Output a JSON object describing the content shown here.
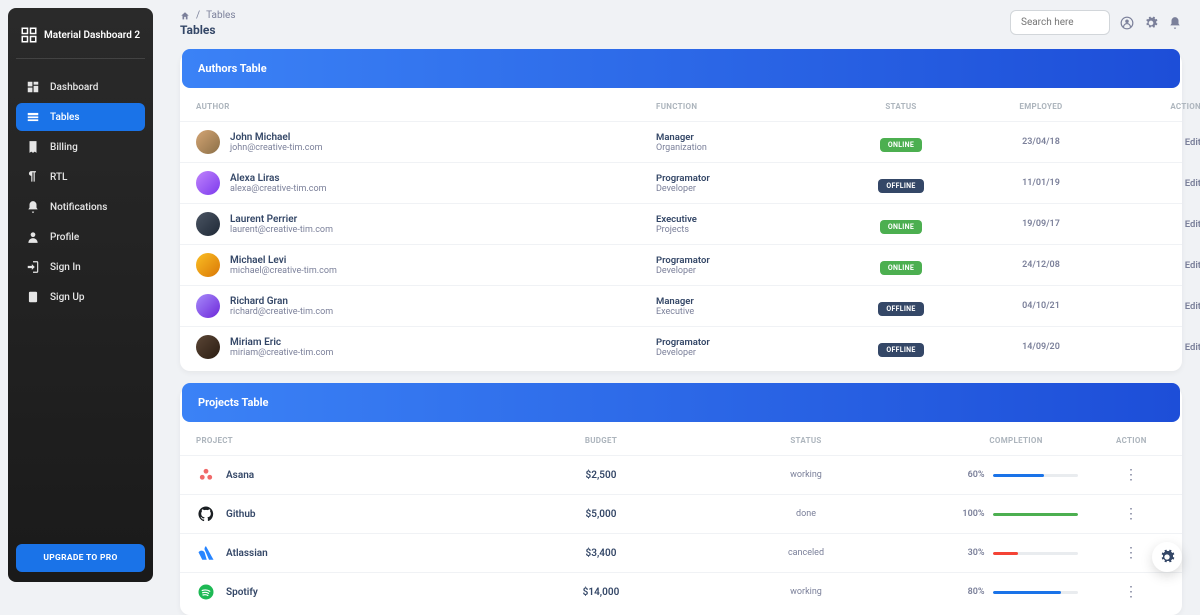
{
  "brand": {
    "name": "Material Dashboard 2"
  },
  "sidebar": {
    "items": [
      {
        "label": "Dashboard"
      },
      {
        "label": "Tables"
      },
      {
        "label": "Billing"
      },
      {
        "label": "RTL"
      },
      {
        "label": "Notifications"
      },
      {
        "label": "Profile"
      },
      {
        "label": "Sign In"
      },
      {
        "label": "Sign Up"
      }
    ],
    "upgrade_label": "UPGRADE TO PRO"
  },
  "breadcrumb": {
    "current": "Tables",
    "page_title": "Tables"
  },
  "search": {
    "placeholder": "Search here"
  },
  "authors_table": {
    "title": "Authors Table",
    "headers": {
      "author": "AUTHOR",
      "function": "FUNCTION",
      "status": "STATUS",
      "employed": "EMPLOYED",
      "action": "ACTION"
    },
    "action_label": "Edit",
    "status_labels": {
      "online": "ONLINE",
      "offline": "OFFLINE"
    },
    "rows": [
      {
        "name": "John Michael",
        "email": "john@creative-tim.com",
        "role": "Manager",
        "dept": "Organization",
        "status": "online",
        "employed": "23/04/18"
      },
      {
        "name": "Alexa Liras",
        "email": "alexa@creative-tim.com",
        "role": "Programator",
        "dept": "Developer",
        "status": "offline",
        "employed": "11/01/19"
      },
      {
        "name": "Laurent Perrier",
        "email": "laurent@creative-tim.com",
        "role": "Executive",
        "dept": "Projects",
        "status": "online",
        "employed": "19/09/17"
      },
      {
        "name": "Michael Levi",
        "email": "michael@creative-tim.com",
        "role": "Programator",
        "dept": "Developer",
        "status": "online",
        "employed": "24/12/08"
      },
      {
        "name": "Richard Gran",
        "email": "richard@creative-tim.com",
        "role": "Manager",
        "dept": "Executive",
        "status": "offline",
        "employed": "04/10/21"
      },
      {
        "name": "Miriam Eric",
        "email": "miriam@creative-tim.com",
        "role": "Programator",
        "dept": "Developer",
        "status": "offline",
        "employed": "14/09/20"
      }
    ]
  },
  "projects_table": {
    "title": "Projects Table",
    "headers": {
      "project": "PROJECT",
      "budget": "BUDGET",
      "status": "STATUS",
      "completion": "COMPLETION",
      "action": "ACTION"
    },
    "rows": [
      {
        "name": "Asana",
        "budget": "$2,500",
        "status": "working",
        "completion": "60%",
        "pct": 60,
        "color": "blue",
        "logo": "asana"
      },
      {
        "name": "Github",
        "budget": "$5,000",
        "status": "done",
        "completion": "100%",
        "pct": 100,
        "color": "green",
        "logo": "github"
      },
      {
        "name": "Atlassian",
        "budget": "$3,400",
        "status": "canceled",
        "completion": "30%",
        "pct": 30,
        "color": "red",
        "logo": "atlassian"
      },
      {
        "name": "Spotify",
        "budget": "$14,000",
        "status": "working",
        "completion": "80%",
        "pct": 80,
        "color": "blue",
        "logo": "spotify"
      }
    ]
  }
}
